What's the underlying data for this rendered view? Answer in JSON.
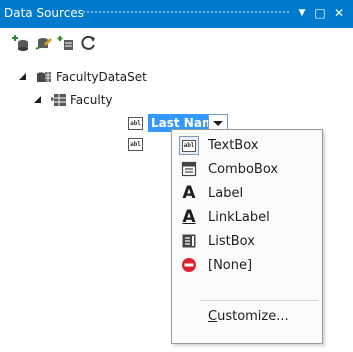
{
  "window": {
    "title": "Data Sources",
    "menu_glyph": "▼",
    "maximize_glyph": "□",
    "close_glyph": "✕"
  },
  "toolbar": {
    "buttons": [
      {
        "icon": "add-data-source-icon"
      },
      {
        "icon": "edit-dataset-icon"
      },
      {
        "icon": "configure-dataset-icon"
      },
      {
        "icon": "refresh-icon"
      }
    ]
  },
  "tree": {
    "dataset": "FacultyDataSet",
    "table": "Faculty",
    "selected_field": "Last Name",
    "field_icon_text": "abl"
  },
  "menu": {
    "items": [
      {
        "label": "TextBox",
        "icon": "textbox-icon",
        "checked": true
      },
      {
        "label": "ComboBox",
        "icon": "combobox-icon"
      },
      {
        "label": "Label",
        "icon": "label-icon"
      },
      {
        "label": "LinkLabel",
        "icon": "linklabel-icon"
      },
      {
        "label": "ListBox",
        "icon": "listbox-icon"
      },
      {
        "label": "[None]",
        "icon": "none-icon"
      }
    ],
    "customize": "Customize..."
  },
  "colors": {
    "titlebar": "#007acc",
    "selection": "#3399ff",
    "none_red": "#e0202a"
  }
}
